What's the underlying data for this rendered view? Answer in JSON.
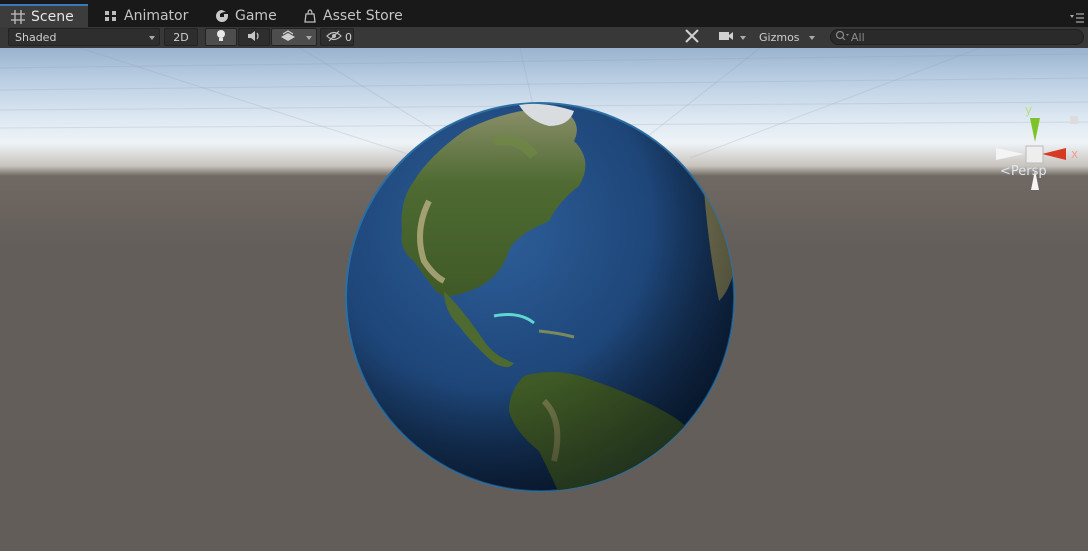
{
  "tabs": [
    {
      "label": "Scene",
      "icon": "grid-icon",
      "active": true
    },
    {
      "label": "Animator",
      "icon": "animator-icon",
      "active": false
    },
    {
      "label": "Game",
      "icon": "game-icon",
      "active": false
    },
    {
      "label": "Asset Store",
      "icon": "store-icon",
      "active": false
    }
  ],
  "toolbar": {
    "draw_mode": "Shaded",
    "mode_2d": "2D",
    "hidden_count": "0",
    "gizmos": "Gizmos",
    "search_placeholder": "All"
  },
  "scene": {
    "projection": "Persp",
    "gizmo_axes": {
      "y": "y",
      "x": "x"
    }
  },
  "colors": {
    "tab_accent": "#3a79bb",
    "gizmo_y": "#7ec32a",
    "gizmo_x": "#d73a22"
  }
}
